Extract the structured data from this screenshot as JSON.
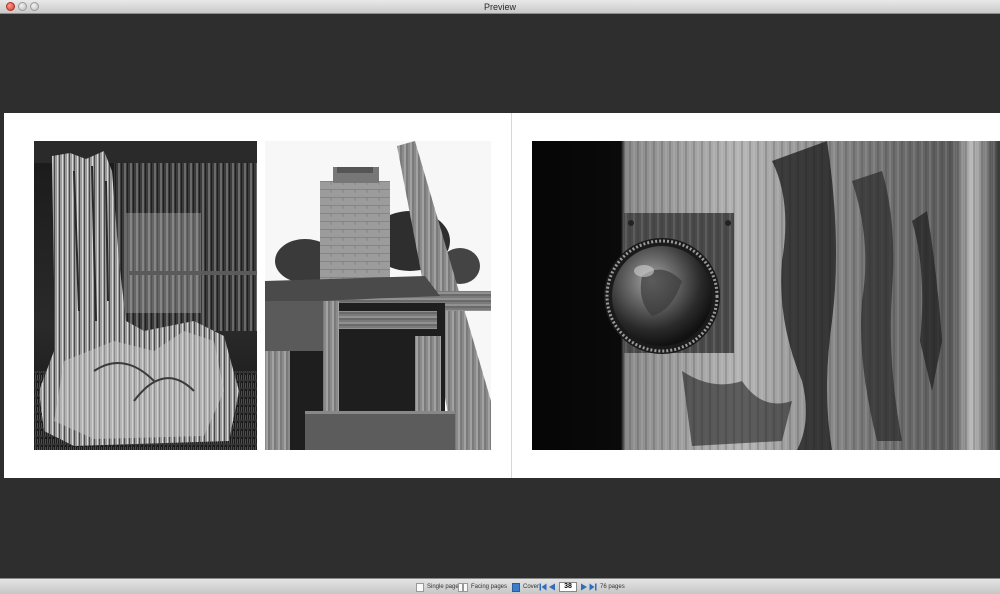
{
  "window": {
    "title": "Preview"
  },
  "toolbar": {
    "single_label": "Single page",
    "facing_label": "Facing pages",
    "cover_label": "Cover",
    "page_value": "38",
    "pages_label": "76 pages"
  },
  "icons": [
    "close-icon",
    "minimize-icon",
    "zoom-icon",
    "single-page-icon",
    "facing-pages-icon",
    "cover-icon",
    "first-page-icon",
    "previous-page-icon",
    "next-page-icon",
    "last-page-icon"
  ],
  "colors": {
    "background": "#2e2e2e",
    "page": "#ffffff",
    "accent": "#3a7dc9"
  }
}
